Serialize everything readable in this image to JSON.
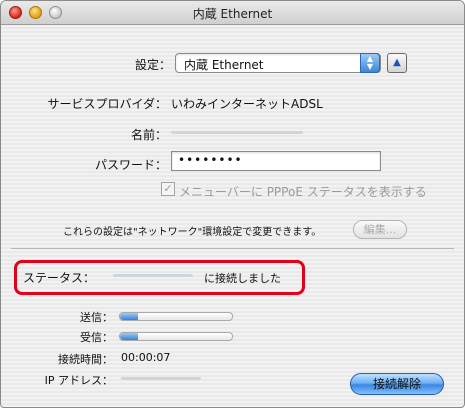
{
  "window": {
    "title": "内蔵 Ethernet"
  },
  "settings": {
    "label": "設定：",
    "popup_value": "内蔵 Ethernet"
  },
  "provider": {
    "label": "サービスプロバイダ：",
    "value": "いわみインターネットADSL"
  },
  "name": {
    "label": "名前："
  },
  "password": {
    "label": "パスワード：",
    "value": "••••••••"
  },
  "menubar_option": {
    "label": "メニューバーに PPPoE ステータスを表示する",
    "checked": true
  },
  "note": {
    "text": "これらの設定は\"ネットワーク\"環境設定で変更できます。",
    "edit_label": "編集..."
  },
  "status": {
    "label": "ステータス：",
    "value": "に接続しました"
  },
  "sent": {
    "label": "送信：",
    "level": 0.16
  },
  "received": {
    "label": "受信：",
    "level": 0.16
  },
  "connect_time": {
    "label": "接続時間：",
    "value": "00:00:07"
  },
  "ip": {
    "label": "IP アドレス："
  },
  "disconnect": {
    "label": "接続解除"
  },
  "colors": {
    "accent": "#3b86e0",
    "highlight": "#e0001a"
  },
  "icons": [
    "close-light",
    "minimize-light",
    "zoom-light",
    "popup-arrows-icon",
    "eject-icon",
    "checkmark-icon"
  ]
}
